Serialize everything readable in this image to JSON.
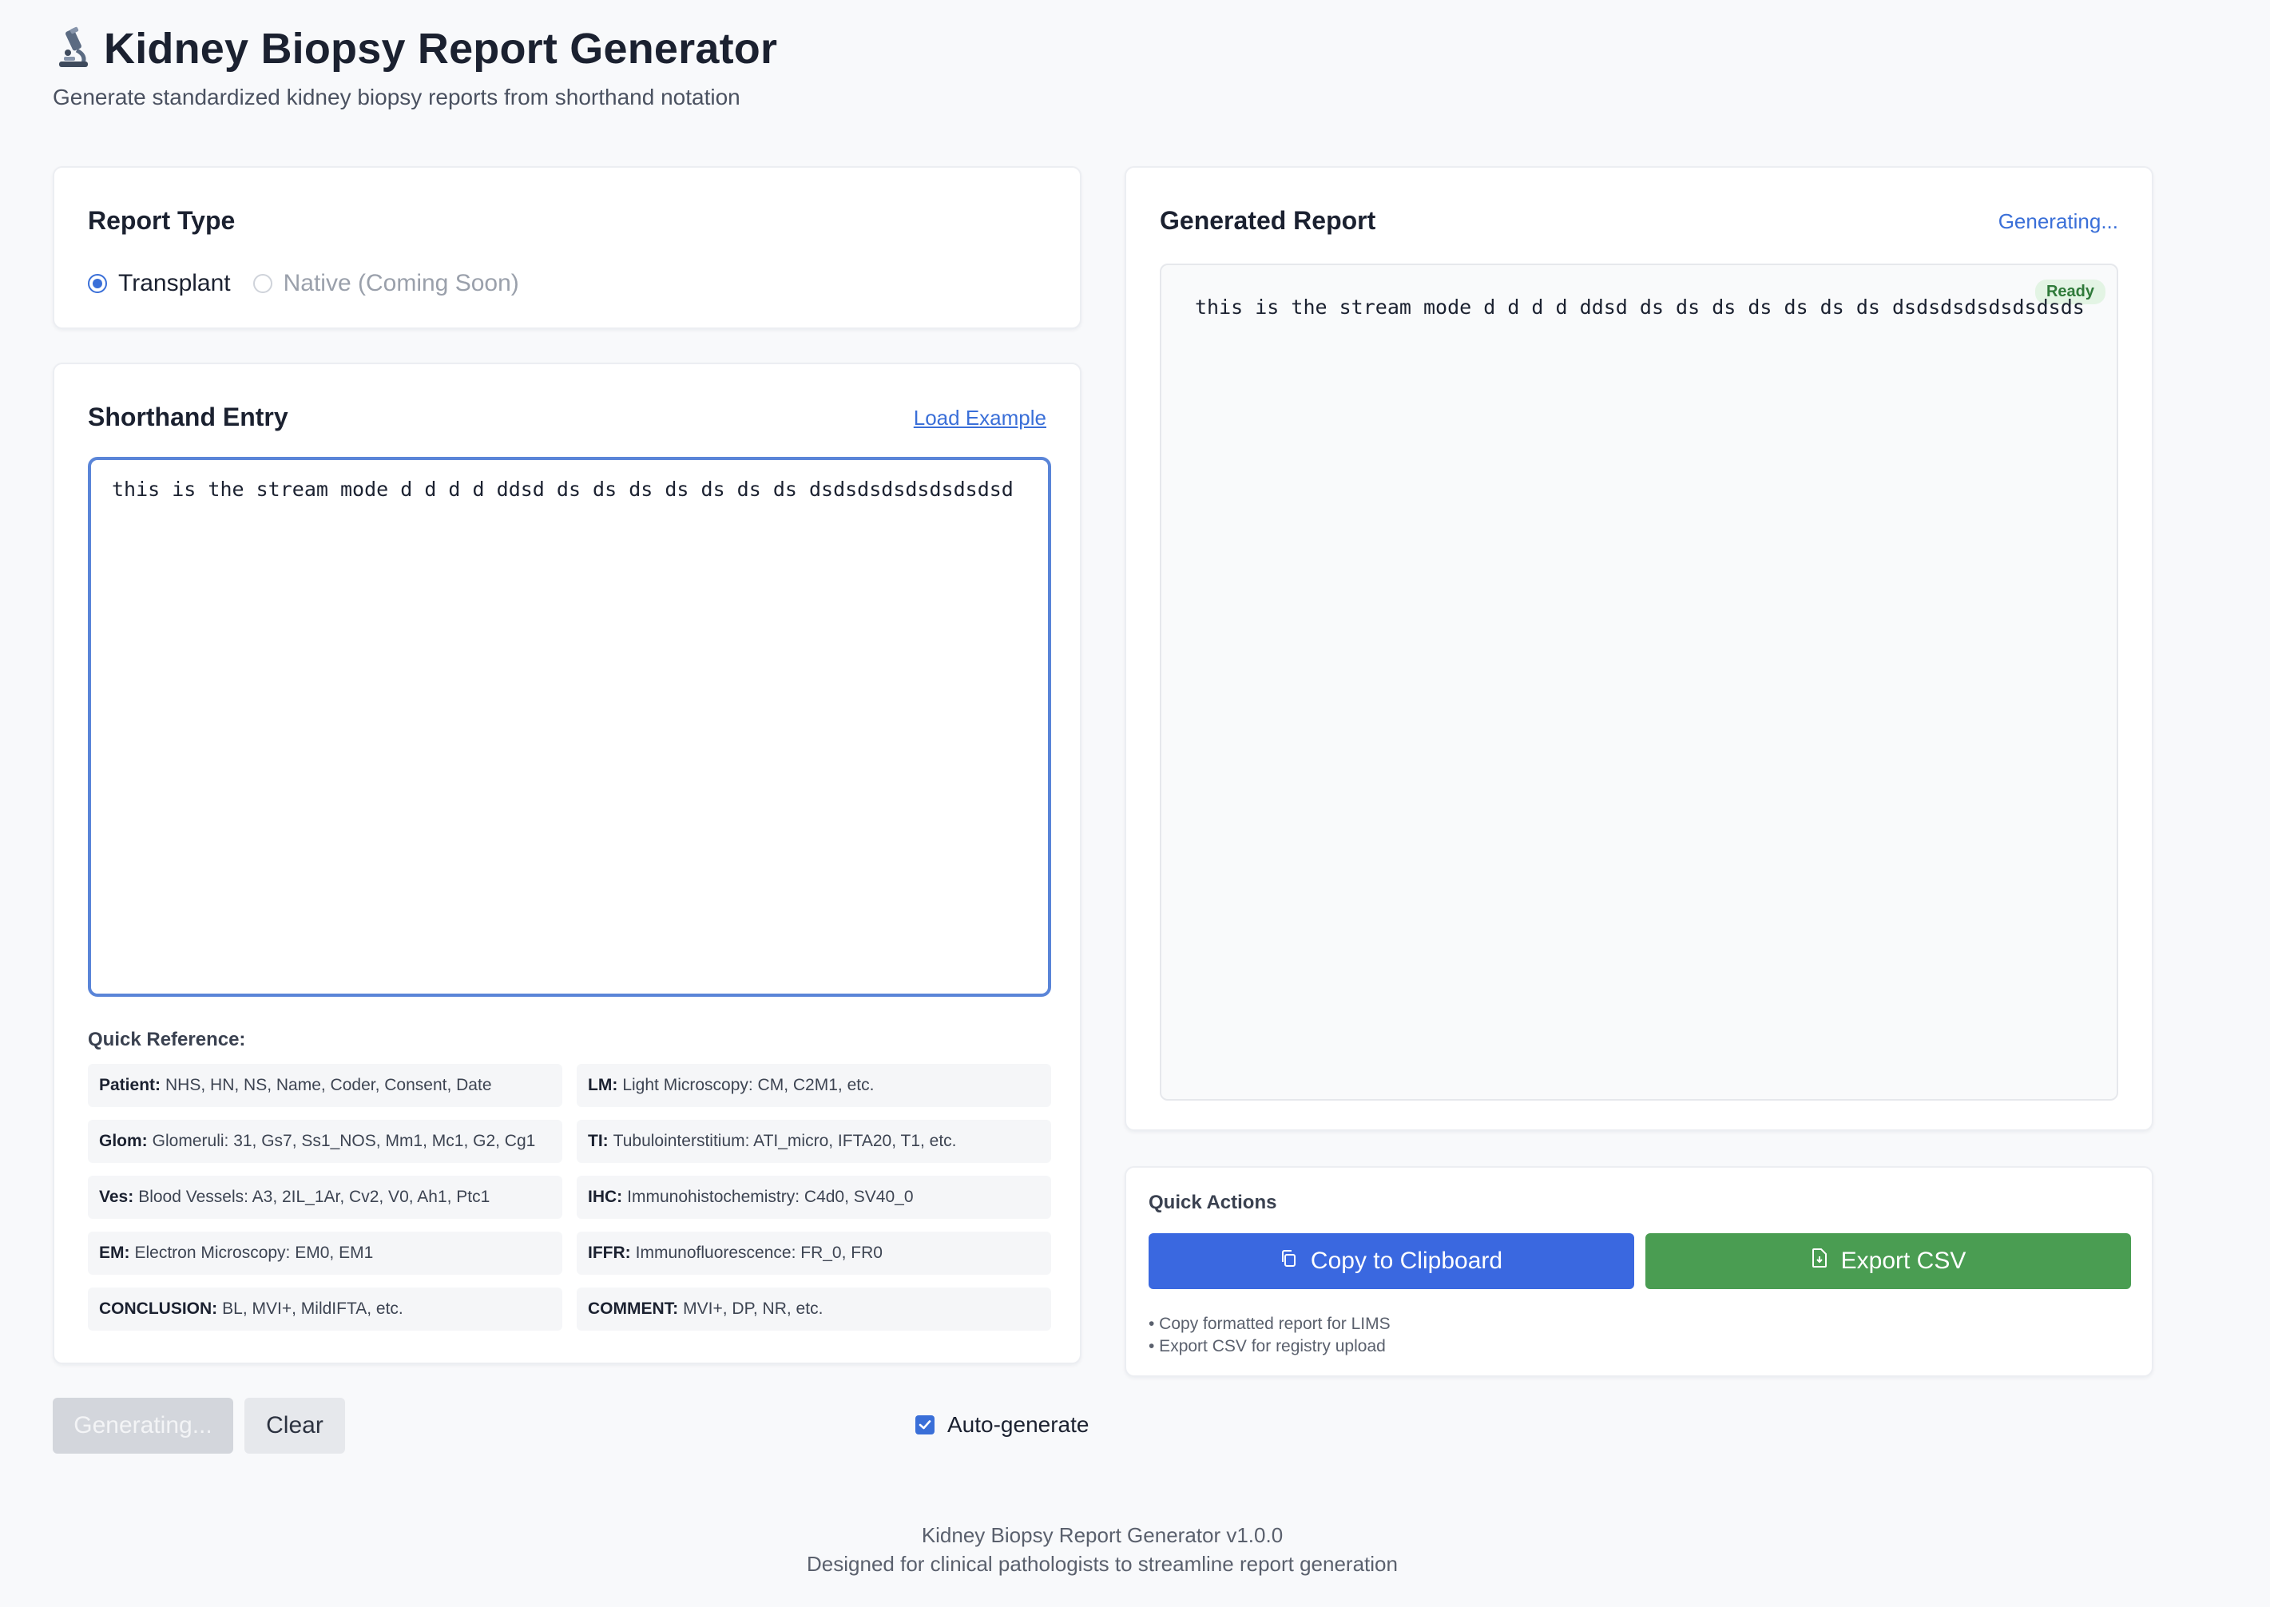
{
  "header": {
    "icon": "microscope-icon",
    "title": "Kidney Biopsy Report Generator",
    "subtitle": "Generate standardized kidney biopsy reports from shorthand notation"
  },
  "report_type": {
    "title": "Report Type",
    "options": [
      {
        "label": "Transplant",
        "selected": true,
        "disabled": false
      },
      {
        "label": "Native (Coming Soon)",
        "selected": false,
        "disabled": true
      }
    ]
  },
  "shorthand": {
    "title": "Shorthand Entry",
    "load_example_label": "Load Example",
    "value": "this is the stream mode d d d d ddsd ds ds ds ds ds ds ds dsdsdsdsdsdsdsdsd",
    "quick_reference_label": "Quick Reference:",
    "quick_reference": [
      {
        "key": "Patient:",
        "desc": "NHS, HN, NS, Name, Coder, Consent, Date"
      },
      {
        "key": "LM:",
        "desc": "Light Microscopy: CM, C2M1, etc."
      },
      {
        "key": "Glom:",
        "desc": "Glomeruli: 31, Gs7, Ss1_NOS, Mm1, Mc1, G2, Cg1"
      },
      {
        "key": "TI:",
        "desc": "Tubulointerstitium: ATI_micro, IFTA20, T1, etc."
      },
      {
        "key": "Ves:",
        "desc": "Blood Vessels: A3, 2IL_1Ar, Cv2, V0, Ah1, Ptc1"
      },
      {
        "key": "IHC:",
        "desc": "Immunohistochemistry: C4d0, SV40_0"
      },
      {
        "key": "EM:",
        "desc": "Electron Microscopy: EM0, EM1"
      },
      {
        "key": "IFFR:",
        "desc": "Immunofluorescence: FR_0, FR0"
      },
      {
        "key": "CONCLUSION:",
        "desc": "BL, MVI+, MildIFTA, etc."
      },
      {
        "key": "COMMENT:",
        "desc": "MVI+, DP, NR, etc."
      }
    ]
  },
  "controls": {
    "generate_label": "Generating...",
    "clear_label": "Clear",
    "auto_generate_label": "Auto-generate",
    "auto_generate_checked": true
  },
  "report": {
    "title": "Generated Report",
    "status": "Generating...",
    "badge": "Ready",
    "text": "this is the stream mode d d d d ddsd ds ds ds ds ds ds ds dsdsdsdsdsdsdsds"
  },
  "quick_actions": {
    "title": "Quick Actions",
    "copy_label": "Copy to Clipboard",
    "copy_icon": "copy-icon",
    "export_label": "Export CSV",
    "export_icon": "file-icon",
    "notes": [
      "• Copy formatted report for LIMS",
      "• Export CSV for registry upload"
    ]
  },
  "footer": {
    "line1": "Kidney Biopsy Report Generator v1.0.0",
    "line2": "Designed for clinical pathologists to streamline report generation"
  },
  "colors": {
    "accent": "#3a68e0",
    "success": "#4a9d52",
    "badge_bg": "#e3f4e4"
  }
}
